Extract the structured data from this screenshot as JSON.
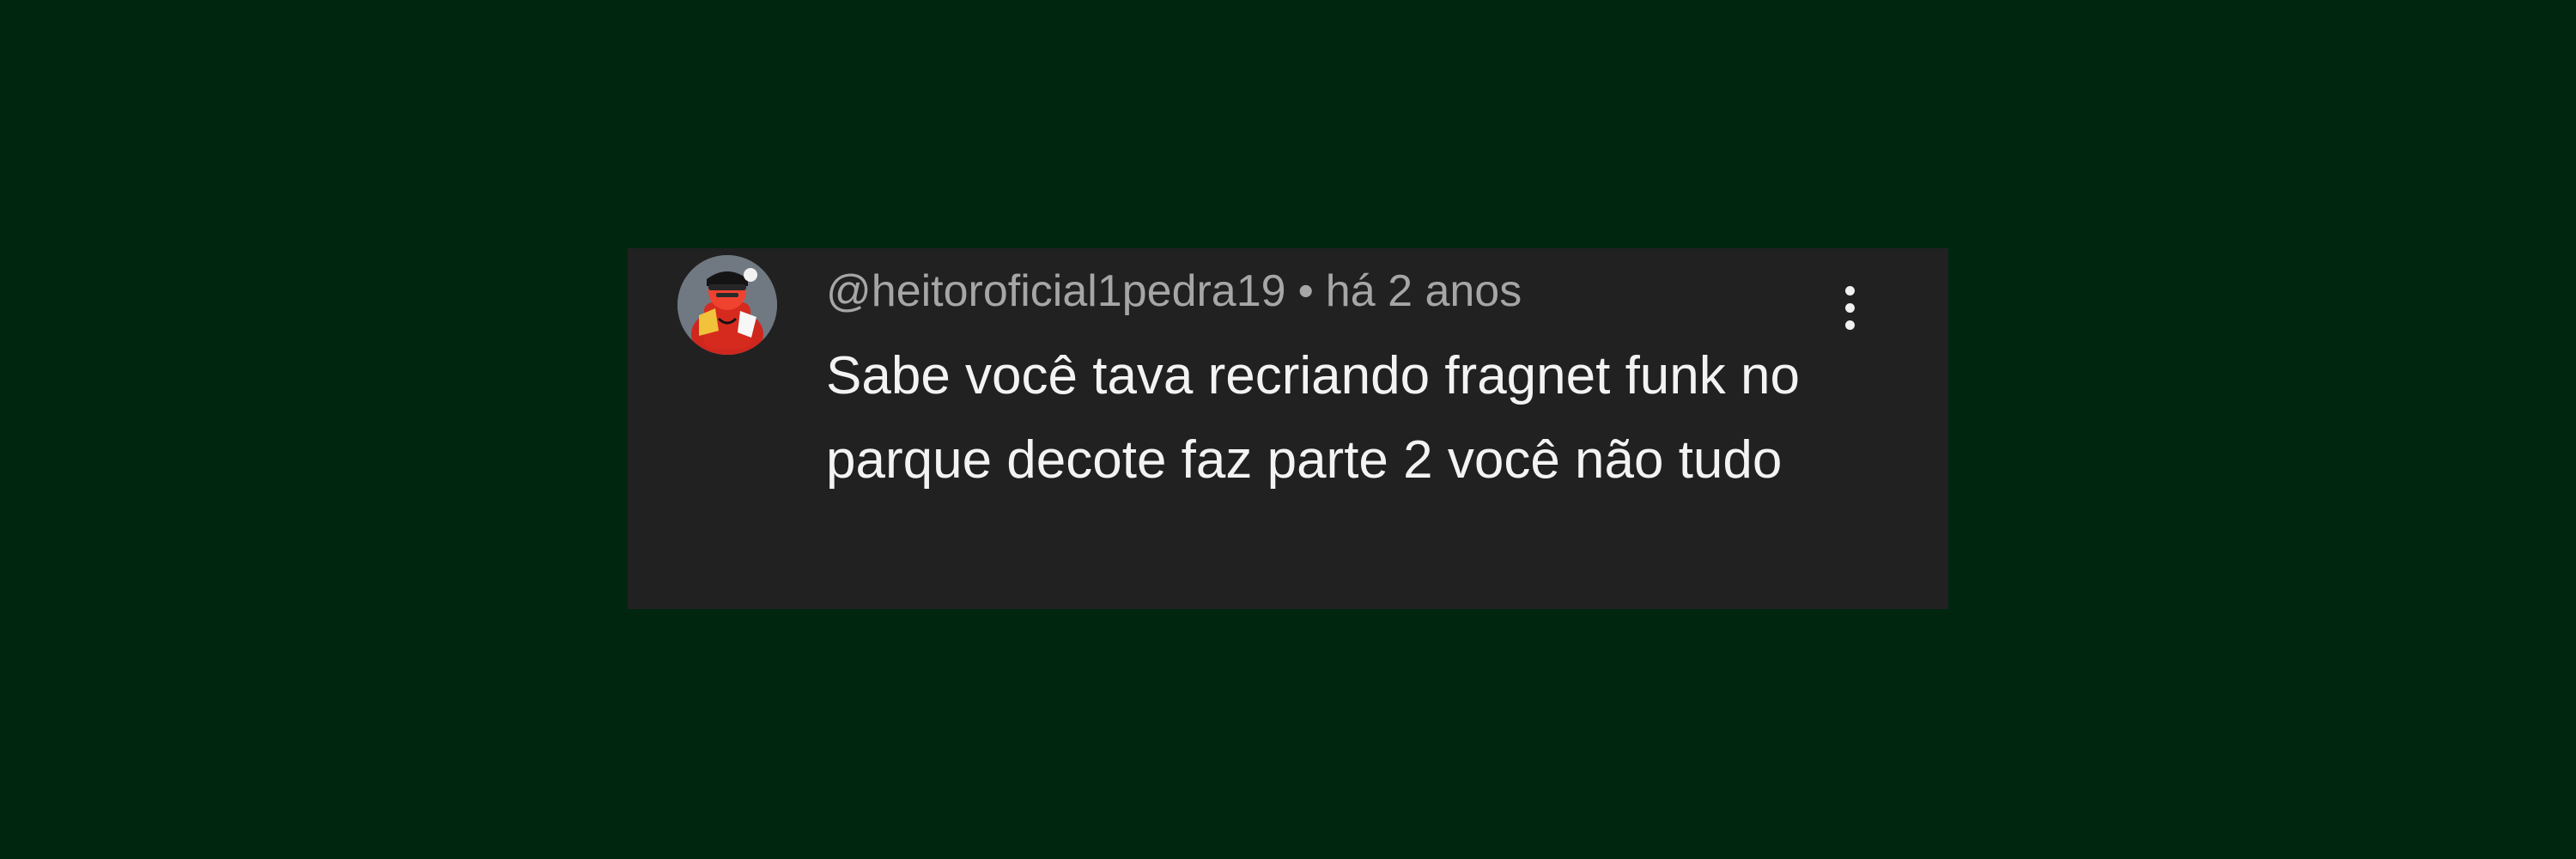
{
  "comment": {
    "username": "@heitoroficial1pedra19",
    "separator": "•",
    "timestamp": "há 2 anos",
    "text": "Sabe você tava recriando fragnet funk no parque decote faz parte 2 você não tudo"
  },
  "icons": {
    "avatar": "user-avatar-image",
    "menu": "more-vertical-icon"
  },
  "colors": {
    "page_background": "#012610",
    "card_background": "#212121",
    "username_text": "#a6a6a6",
    "comment_text": "#f3f3f3",
    "menu_dots": "#f1f1f1"
  }
}
